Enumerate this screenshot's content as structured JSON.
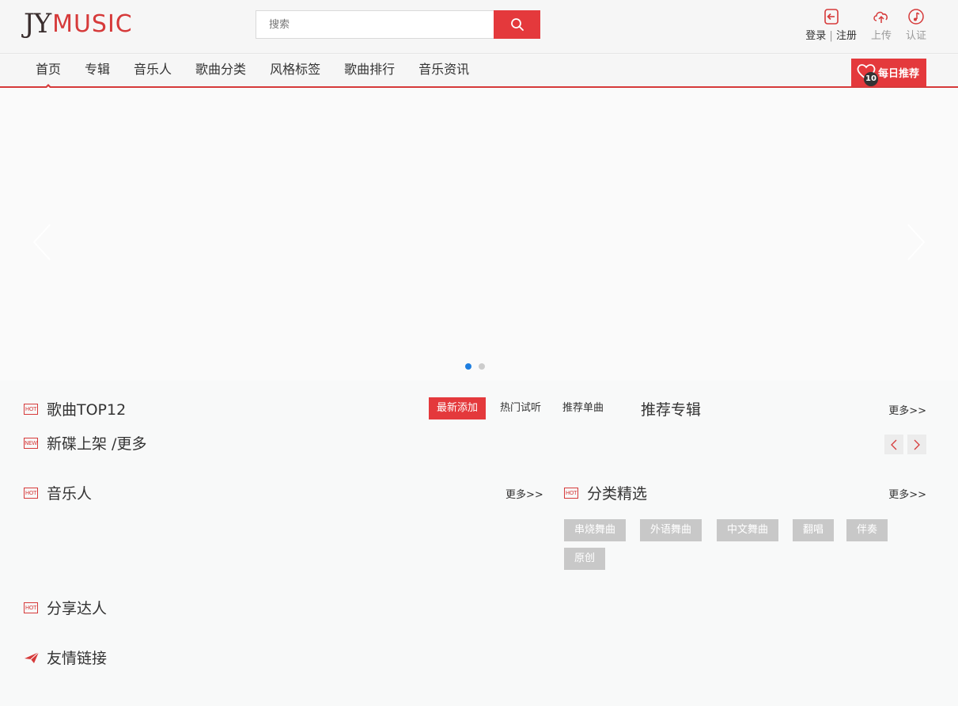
{
  "logo": {
    "part1": "JY",
    "part2": "MUSIC"
  },
  "search": {
    "placeholder": "搜索"
  },
  "user_actions": {
    "login": "登录",
    "separator": "|",
    "register": "注册",
    "upload": "上传",
    "certify": "认证"
  },
  "nav": {
    "items": [
      "首页",
      "专辑",
      "音乐人",
      "歌曲分类",
      "风格标签",
      "歌曲排行",
      "音乐资讯"
    ],
    "active_index": 0,
    "daily": {
      "badge": "10",
      "label": "每日推荐"
    }
  },
  "banner": {
    "dots": 2,
    "active_dot": 0
  },
  "sections": {
    "top12": {
      "icon": "HOT",
      "title": "歌曲TOP12",
      "tabs": [
        "最新添加",
        "热门试听",
        "推荐单曲"
      ]
    },
    "albums": {
      "title": "推荐专辑",
      "more": "更多>>"
    },
    "new_release": {
      "icon": "NEW",
      "title": "新碟上架 /更多"
    },
    "musicians": {
      "icon": "HOT",
      "title": "音乐人",
      "more": "更多>>"
    },
    "categories": {
      "icon": "HOT",
      "title": "分类精选",
      "more": "更多>>",
      "tags": [
        "串烧舞曲",
        "外语舞曲",
        "中文舞曲",
        "翻唱",
        "伴奏",
        "原创"
      ]
    },
    "sharers": {
      "icon": "HOT",
      "title": "分享达人"
    },
    "links": {
      "title": "友情链接"
    }
  },
  "colors": {
    "accent": "#e4393c",
    "dot_active": "#1e7ee0"
  }
}
